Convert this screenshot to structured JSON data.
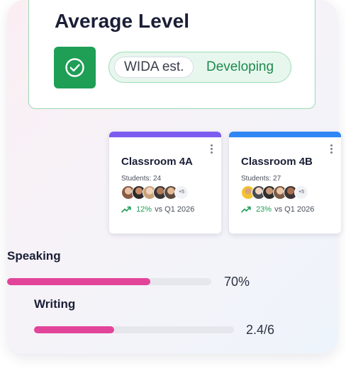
{
  "average_level": {
    "title": "Average Level",
    "badge_label": "WIDA est.",
    "status": "Developing"
  },
  "classrooms": [
    {
      "name": "Classroom 4A",
      "students": "Students: 24",
      "more_count": "+5",
      "trend_pct": "12%",
      "trend_compare": "vs Q1 2026",
      "accent": "#7c5cf0"
    },
    {
      "name": "Classroom 4B",
      "students": "Students: 27",
      "more_count": "+5",
      "trend_pct": "23%",
      "trend_compare": "vs Q1 2026",
      "accent": "#2f86f4"
    }
  ],
  "skills": [
    {
      "label": "Speaking",
      "value": "70%",
      "progress": 0.7
    },
    {
      "label": "Writing",
      "value": "2.4/6",
      "progress": 0.4
    }
  ],
  "colors": {
    "success_green": "#1f9e56",
    "progress_pink": "#e2449a",
    "track_gray": "#e6e7ec"
  },
  "icons": {
    "check": "check-circle-icon",
    "trend": "trending-up-icon",
    "menu": "more-vertical-icon"
  }
}
